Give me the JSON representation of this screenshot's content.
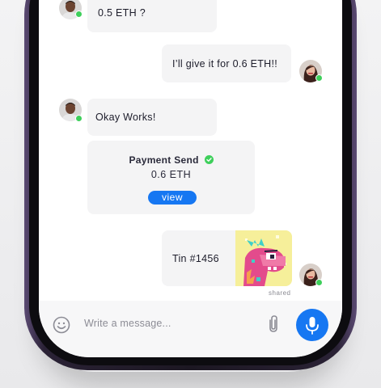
{
  "messages": [
    {
      "from": "other",
      "text": "0.5 ETH ?"
    },
    {
      "from": "me",
      "text": "I’ll give it for 0.6 ETH!!"
    },
    {
      "from": "other",
      "text": "Okay Works!"
    }
  ],
  "payment_card": {
    "title": "Payment Send",
    "amount": "0.6 ETH",
    "button_label": "view"
  },
  "nft_message": {
    "text": "Tin #1456",
    "caption": "shared"
  },
  "composer": {
    "placeholder": "Write a message..."
  },
  "colors": {
    "accent": "#1677f2",
    "online": "#3ecf5b",
    "bubble": "#f4f4f5"
  }
}
